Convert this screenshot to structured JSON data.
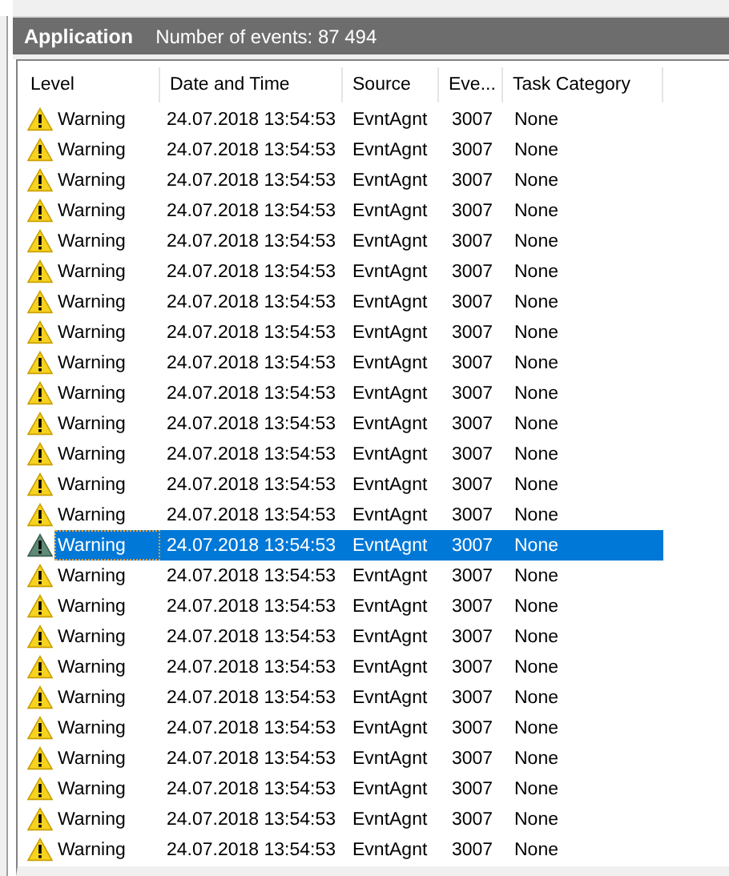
{
  "title_bar": {
    "log_name": "Application",
    "event_count": "Number of events: 87 494"
  },
  "table": {
    "columns": [
      "Level",
      "Date and Time",
      "Source",
      "Eve...",
      "Task Category"
    ],
    "rows": [
      {
        "level": "Warning",
        "date_time": "24.07.2018 13:54:53",
        "source": "EvntAgnt",
        "event_id": "3007",
        "task_category": "None",
        "selected": false
      },
      {
        "level": "Warning",
        "date_time": "24.07.2018 13:54:53",
        "source": "EvntAgnt",
        "event_id": "3007",
        "task_category": "None",
        "selected": false
      },
      {
        "level": "Warning",
        "date_time": "24.07.2018 13:54:53",
        "source": "EvntAgnt",
        "event_id": "3007",
        "task_category": "None",
        "selected": false
      },
      {
        "level": "Warning",
        "date_time": "24.07.2018 13:54:53",
        "source": "EvntAgnt",
        "event_id": "3007",
        "task_category": "None",
        "selected": false
      },
      {
        "level": "Warning",
        "date_time": "24.07.2018 13:54:53",
        "source": "EvntAgnt",
        "event_id": "3007",
        "task_category": "None",
        "selected": false
      },
      {
        "level": "Warning",
        "date_time": "24.07.2018 13:54:53",
        "source": "EvntAgnt",
        "event_id": "3007",
        "task_category": "None",
        "selected": false
      },
      {
        "level": "Warning",
        "date_time": "24.07.2018 13:54:53",
        "source": "EvntAgnt",
        "event_id": "3007",
        "task_category": "None",
        "selected": false
      },
      {
        "level": "Warning",
        "date_time": "24.07.2018 13:54:53",
        "source": "EvntAgnt",
        "event_id": "3007",
        "task_category": "None",
        "selected": false
      },
      {
        "level": "Warning",
        "date_time": "24.07.2018 13:54:53",
        "source": "EvntAgnt",
        "event_id": "3007",
        "task_category": "None",
        "selected": false
      },
      {
        "level": "Warning",
        "date_time": "24.07.2018 13:54:53",
        "source": "EvntAgnt",
        "event_id": "3007",
        "task_category": "None",
        "selected": false
      },
      {
        "level": "Warning",
        "date_time": "24.07.2018 13:54:53",
        "source": "EvntAgnt",
        "event_id": "3007",
        "task_category": "None",
        "selected": false
      },
      {
        "level": "Warning",
        "date_time": "24.07.2018 13:54:53",
        "source": "EvntAgnt",
        "event_id": "3007",
        "task_category": "None",
        "selected": false
      },
      {
        "level": "Warning",
        "date_time": "24.07.2018 13:54:53",
        "source": "EvntAgnt",
        "event_id": "3007",
        "task_category": "None",
        "selected": false
      },
      {
        "level": "Warning",
        "date_time": "24.07.2018 13:54:53",
        "source": "EvntAgnt",
        "event_id": "3007",
        "task_category": "None",
        "selected": false
      },
      {
        "level": "Warning",
        "date_time": "24.07.2018 13:54:53",
        "source": "EvntAgnt",
        "event_id": "3007",
        "task_category": "None",
        "selected": true
      },
      {
        "level": "Warning",
        "date_time": "24.07.2018 13:54:53",
        "source": "EvntAgnt",
        "event_id": "3007",
        "task_category": "None",
        "selected": false
      },
      {
        "level": "Warning",
        "date_time": "24.07.2018 13:54:53",
        "source": "EvntAgnt",
        "event_id": "3007",
        "task_category": "None",
        "selected": false
      },
      {
        "level": "Warning",
        "date_time": "24.07.2018 13:54:53",
        "source": "EvntAgnt",
        "event_id": "3007",
        "task_category": "None",
        "selected": false
      },
      {
        "level": "Warning",
        "date_time": "24.07.2018 13:54:53",
        "source": "EvntAgnt",
        "event_id": "3007",
        "task_category": "None",
        "selected": false
      },
      {
        "level": "Warning",
        "date_time": "24.07.2018 13:54:53",
        "source": "EvntAgnt",
        "event_id": "3007",
        "task_category": "None",
        "selected": false
      },
      {
        "level": "Warning",
        "date_time": "24.07.2018 13:54:53",
        "source": "EvntAgnt",
        "event_id": "3007",
        "task_category": "None",
        "selected": false
      },
      {
        "level": "Warning",
        "date_time": "24.07.2018 13:54:53",
        "source": "EvntAgnt",
        "event_id": "3007",
        "task_category": "None",
        "selected": false
      },
      {
        "level": "Warning",
        "date_time": "24.07.2018 13:54:53",
        "source": "EvntAgnt",
        "event_id": "3007",
        "task_category": "None",
        "selected": false
      },
      {
        "level": "Warning",
        "date_time": "24.07.2018 13:54:53",
        "source": "EvntAgnt",
        "event_id": "3007",
        "task_category": "None",
        "selected": false
      },
      {
        "level": "Warning",
        "date_time": "24.07.2018 13:54:53",
        "source": "EvntAgnt",
        "event_id": "3007",
        "task_category": "None",
        "selected": false
      }
    ]
  }
}
